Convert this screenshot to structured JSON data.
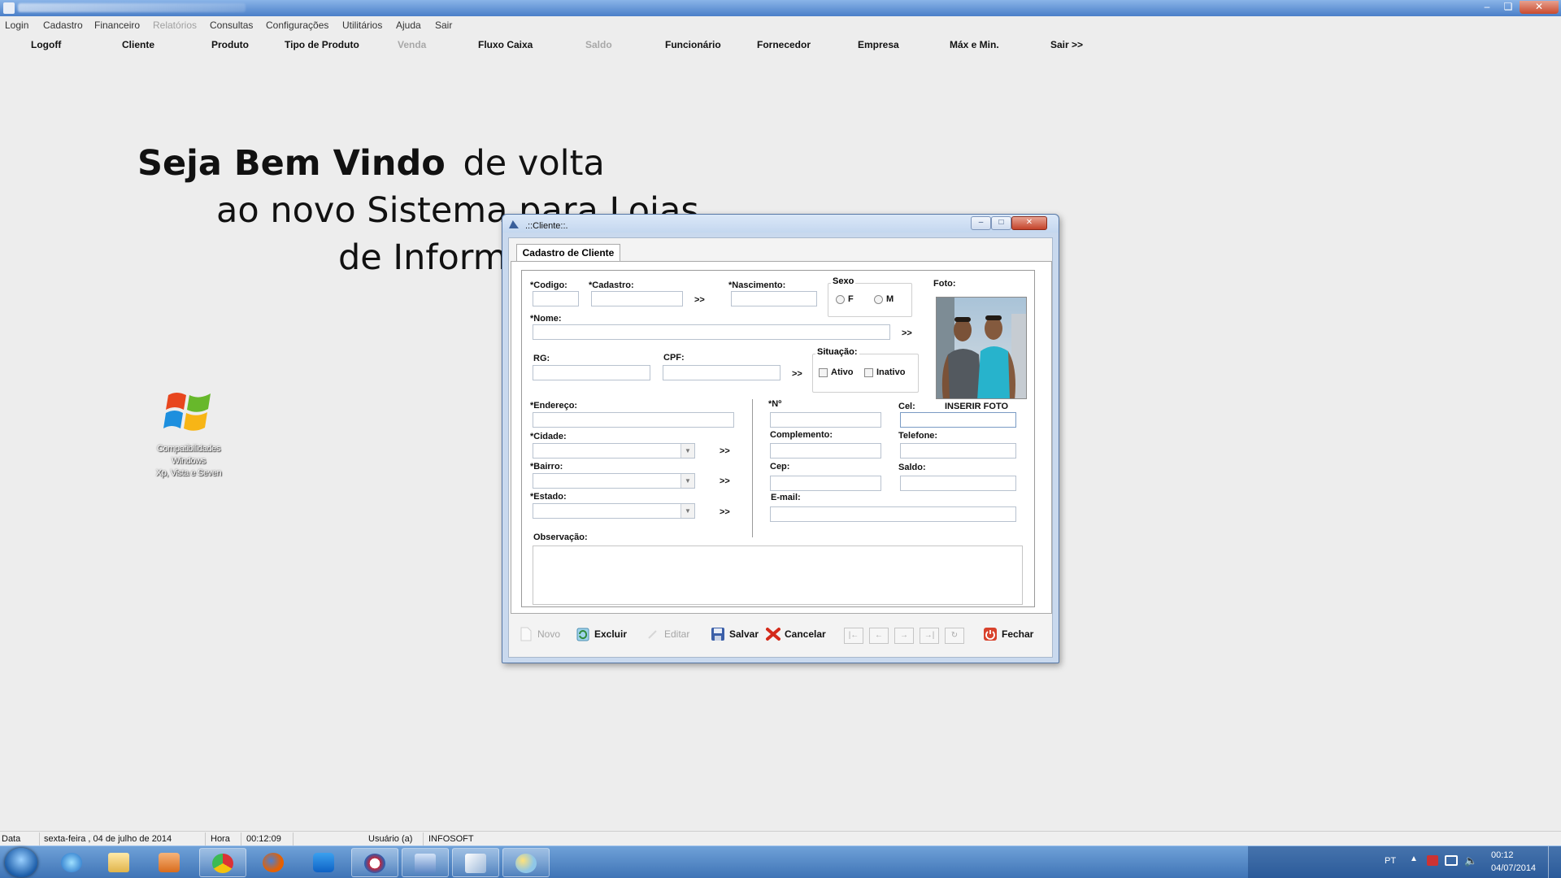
{
  "menu": [
    "Login",
    "Cadastro",
    "Financeiro",
    "Relatórios",
    "Consultas",
    "Configurações",
    "Utilitários",
    "Ajuda",
    "Sair"
  ],
  "toolbar": [
    "Logoff",
    "Cliente",
    "Produto",
    "Tipo de Produto",
    "Venda",
    "Fluxo Caixa",
    "Saldo",
    "Funcionário",
    "Fornecedor",
    "Empresa",
    "Máx e Min.",
    "Sair >>"
  ],
  "welcome": {
    "line1_bold": "Seja Bem Vindo",
    "line1_rest": "de volta",
    "line2": "ao novo Sistema para Lojas",
    "line3": "de Informa"
  },
  "desktop_icon": {
    "label1": "Compatibilidades",
    "label2": "Windows",
    "label3": "Xp, Vista e Seven"
  },
  "dialog": {
    "title": ".::Cliente::.",
    "tab": "Cadastro de Cliente",
    "labels": {
      "codigo": "*Codigo:",
      "cadastro": "*Cadastro:",
      "nascimento": "*Nascimento:",
      "sexo": "Sexo",
      "foto": "Foto:",
      "nome": "*Nome:",
      "rg": "RG:",
      "cpf": "CPF:",
      "situacao": "Situação:",
      "endereco": "*Endereço:",
      "numero": "*Nº",
      "cel": "Cel:",
      "cidade": "*Cidade:",
      "complemento": "Complemento:",
      "telefone": "Telefone:",
      "bairro": "*Bairro:",
      "cep": "Cep:",
      "saldo": "Saldo:",
      "estado": "*Estado:",
      "email": "E-mail:",
      "observacao": "Observação:"
    },
    "sexo_options": [
      "F",
      "M"
    ],
    "situacao_options": [
      "Ativo",
      "Inativo"
    ],
    "more": ">>",
    "inserir_foto": "INSERIR FOTO",
    "actions": {
      "novo": "Novo",
      "excluir": "Excluir",
      "editar": "Editar",
      "salvar": "Salvar",
      "cancelar": "Cancelar",
      "fechar": "Fechar"
    }
  },
  "status": {
    "data_label": "Data",
    "data_value": "sexta-feira , 04  de  julho  de  2014",
    "hora_label": "Hora",
    "hora_value": "00:12:09",
    "usuario_label": "Usuário (a)",
    "usuario_value": "INFOSOFT"
  },
  "tray": {
    "lang": "PT",
    "time": "00:12",
    "date": "04/07/2014"
  },
  "colors": {
    "taskbar": "#3f74b6",
    "titlebar": "#4a7fc8",
    "cancel_red": "#d42a1a",
    "close_red": "#c4432a"
  }
}
